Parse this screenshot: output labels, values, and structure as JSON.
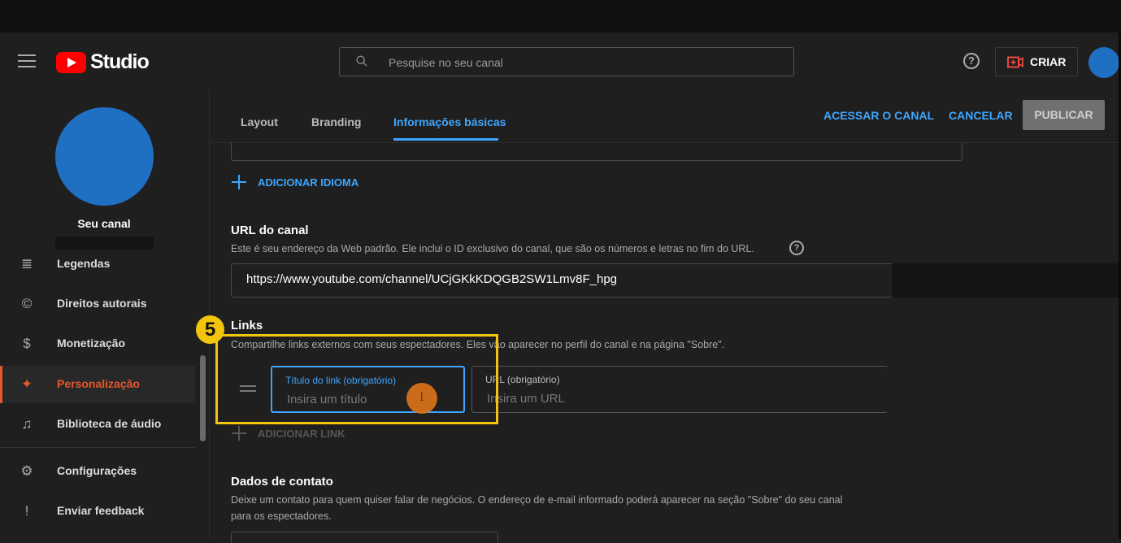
{
  "app": {
    "title": "Studio"
  },
  "header": {
    "search_placeholder": "Pesquise no seu canal",
    "help_glyph": "?",
    "create_label": "CRIAR"
  },
  "sidebar": {
    "channel_name": "Seu canal",
    "items": [
      {
        "label": "Legendas",
        "icon": "subtitles-icon",
        "glyph": "≣"
      },
      {
        "label": "Direitos autorais",
        "icon": "copyright-icon",
        "glyph": "©"
      },
      {
        "label": "Monetização",
        "icon": "dollar-icon",
        "glyph": "$"
      },
      {
        "label": "Personalização",
        "icon": "magic-wand-icon",
        "glyph": "✦",
        "active": true
      },
      {
        "label": "Biblioteca de áudio",
        "icon": "audio-library-icon",
        "glyph": "♫"
      },
      {
        "label": "Configurações",
        "icon": "gear-icon",
        "glyph": "⚙"
      },
      {
        "label": "Enviar feedback",
        "icon": "feedback-icon",
        "glyph": "!"
      }
    ]
  },
  "tabs": [
    {
      "label": "Layout"
    },
    {
      "label": "Branding"
    },
    {
      "label": "Informações básicas",
      "active": true
    }
  ],
  "actions": {
    "view_channel": "ACESSAR O CANAL",
    "cancel": "CANCELAR",
    "publish": "PUBLICAR"
  },
  "add_language": "ADICIONAR IDIOMA",
  "channel_url": {
    "title": "URL do canal",
    "description": "Este é seu endereço da Web padrão. Ele inclui o ID exclusivo do canal, que são os números e letras no fim do URL.",
    "help_glyph": "?",
    "value": "https://www.youtube.com/channel/UCjGKkKDQGB2SW1Lmv8F_hpg"
  },
  "links": {
    "title": "Links",
    "description": "Compartilhe links externos com seus espectadores. Eles vão aparecer no perfil do canal e na página \"Sobre\".",
    "title_field_label": "Título do link (obrigatório)",
    "title_field_placeholder": "Insira um título",
    "url_field_label": "URL (obrigatório)",
    "url_field_placeholder": "Insira um URL",
    "add_link": "ADICIONAR LINK"
  },
  "contact": {
    "title": "Dados de contato",
    "description_line1": "Deixe um contato para quem quiser falar de negócios. O endereço de e-mail informado poderá aparecer na seção \"Sobre\" do seu canal",
    "description_line2": "para os espectadores."
  },
  "annotation": {
    "step": "5",
    "cursor_glyph": "I"
  },
  "colors": {
    "accent": "#3ea6ff",
    "active_nav": "#e4572e",
    "highlight": "#f2c40b",
    "avatar": "#1f6fc3",
    "brand_red": "#ff0000"
  }
}
